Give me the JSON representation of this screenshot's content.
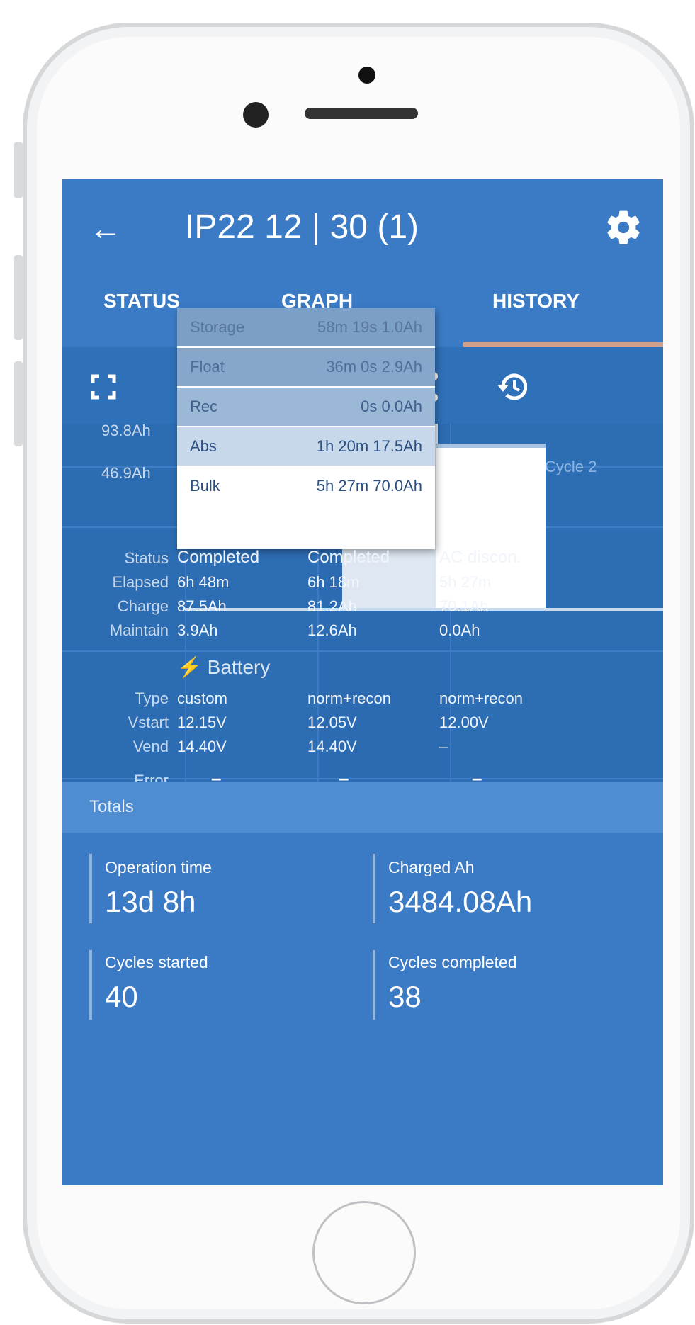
{
  "header": {
    "title": "IP22 12 | 30 (1)"
  },
  "tabs": [
    {
      "label": "STATUS"
    },
    {
      "label": "GRAPH"
    },
    {
      "label": "HISTORY",
      "active": true
    }
  ],
  "chart": {
    "y_ticks": [
      "93.8Ah",
      "46.9Ah"
    ],
    "cycle_label": "Cycle 2"
  },
  "popup": {
    "rows": [
      {
        "name": "Storage",
        "value": "58m 19s  1.0Ah"
      },
      {
        "name": "Float",
        "value": "36m 0s  2.9Ah"
      },
      {
        "name": "Rec",
        "value": "0s  0.0Ah"
      },
      {
        "name": "Abs",
        "value": "1h 20m  17.5Ah"
      },
      {
        "name": "Bulk",
        "value": "5h 27m  70.0Ah"
      }
    ]
  },
  "row_labels": {
    "status": "Status",
    "elapsed": "Elapsed",
    "charge": "Charge",
    "maintain": "Maintain",
    "type": "Type",
    "vstart": "Vstart",
    "vend": "Vend",
    "error": "Error"
  },
  "battery_label": "Battery",
  "cycles": [
    {
      "status": "Completed",
      "elapsed": "6h 48m",
      "charge": "87.5Ah",
      "maintain": "3.9Ah",
      "type": "custom",
      "vstart": "12.15V",
      "vend": "14.40V",
      "error": "–"
    },
    {
      "status": "Completed",
      "elapsed": "6h 18m",
      "charge": "81.2Ah",
      "maintain": "12.6Ah",
      "type": "norm+recon",
      "vstart": "12.05V",
      "vend": "14.40V",
      "error": "–"
    },
    {
      "status": "AC discon.",
      "elapsed": "5h 27m",
      "charge": "70.1Ah",
      "maintain": "0.0Ah",
      "type": "norm+recon",
      "vstart": "12.00V",
      "vend": "–",
      "error": "–"
    }
  ],
  "totals": {
    "label": "Totals",
    "operation_time_label": "Operation time",
    "operation_time": "13d 8h",
    "charged_ah_label": "Charged Ah",
    "charged_ah": "3484.08Ah",
    "cycles_started_label": "Cycles started",
    "cycles_started": "40",
    "cycles_completed_label": "Cycles completed",
    "cycles_completed": "38"
  },
  "colors": {
    "primary": "#3b7bc6",
    "background": "#2e6fb6",
    "accent_underline": "#cfa08e"
  }
}
